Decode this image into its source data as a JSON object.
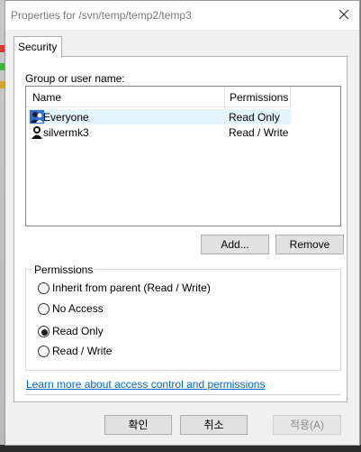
{
  "window": {
    "title": "Properties for /svn/temp/temp2/temp3",
    "close_icon": "close-icon"
  },
  "tab": {
    "label": "Security"
  },
  "group": {
    "label": "Group or user name:",
    "columns": {
      "name": "Name",
      "permissions": "Permissions"
    },
    "rows": [
      {
        "name": "Everyone",
        "permission": "Read Only",
        "icon": "group-users-icon",
        "selected": true
      },
      {
        "name": "silvermk3",
        "permission": "Read / Write",
        "icon": "user-icon",
        "selected": false
      }
    ],
    "add_label": "Add...",
    "remove_label": "Remove"
  },
  "permissions": {
    "legend": "Permissions",
    "options": [
      {
        "label": "Inherit from parent (Read / Write)",
        "checked": false
      },
      {
        "label": "No Access",
        "checked": false
      },
      {
        "label": "Read Only",
        "checked": true
      },
      {
        "label": "Read / Write",
        "checked": false
      }
    ]
  },
  "link": {
    "text": "Learn more about access control and permissions"
  },
  "buttons": {
    "ok": "확인",
    "cancel": "취소",
    "apply": "적용(A)"
  },
  "colors": {
    "link": "#0066cc",
    "selection": "#e5f3ff",
    "apply_disabled": "#8a8a8a"
  }
}
